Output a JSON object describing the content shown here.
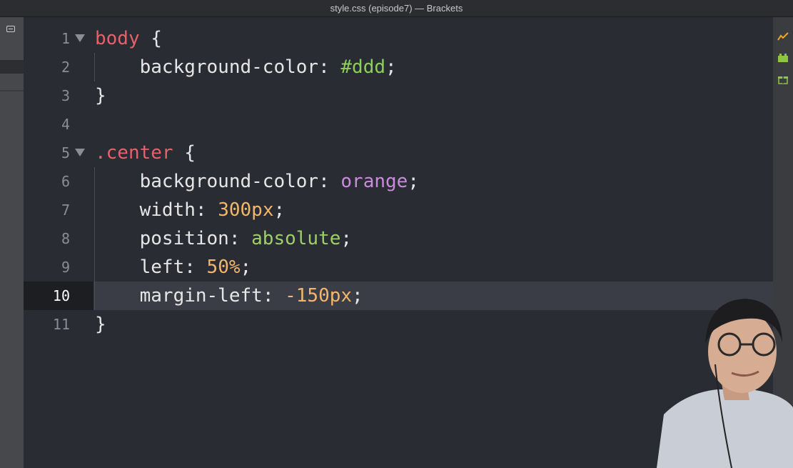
{
  "window": {
    "title": "style.css (episode7) — Brackets"
  },
  "editor": {
    "active_line": "10",
    "lines": [
      {
        "num": "1",
        "fold": true,
        "tokens": [
          [
            "tok-sel",
            "body"
          ],
          [
            "tok-punc",
            " {"
          ]
        ]
      },
      {
        "num": "2",
        "fold": false,
        "indent": true,
        "tokens": [
          [
            "tok-prop",
            "    background-color"
          ],
          [
            "tok-punc",
            ": "
          ],
          [
            "tok-hex",
            "#ddd"
          ],
          [
            "tok-punc",
            ";"
          ]
        ]
      },
      {
        "num": "3",
        "fold": false,
        "tokens": [
          [
            "tok-punc",
            "}"
          ]
        ]
      },
      {
        "num": "4",
        "fold": false,
        "tokens": []
      },
      {
        "num": "5",
        "fold": true,
        "tokens": [
          [
            "tok-sel",
            ".center"
          ],
          [
            "tok-punc",
            " {"
          ]
        ]
      },
      {
        "num": "6",
        "fold": false,
        "indent": true,
        "tokens": [
          [
            "tok-prop",
            "    background-color"
          ],
          [
            "tok-punc",
            ": "
          ],
          [
            "tok-kw",
            "orange"
          ],
          [
            "tok-punc",
            ";"
          ]
        ]
      },
      {
        "num": "7",
        "fold": false,
        "indent": true,
        "tokens": [
          [
            "tok-prop",
            "    width"
          ],
          [
            "tok-punc",
            ": "
          ],
          [
            "tok-num",
            "300px"
          ],
          [
            "tok-punc",
            ";"
          ]
        ]
      },
      {
        "num": "8",
        "fold": false,
        "indent": true,
        "tokens": [
          [
            "tok-prop",
            "    position"
          ],
          [
            "tok-punc",
            ": "
          ],
          [
            "tok-green",
            "absolute"
          ],
          [
            "tok-punc",
            ";"
          ]
        ]
      },
      {
        "num": "9",
        "fold": false,
        "indent": true,
        "tokens": [
          [
            "tok-prop",
            "    left"
          ],
          [
            "tok-punc",
            ": "
          ],
          [
            "tok-num",
            "50%"
          ],
          [
            "tok-punc",
            ";"
          ]
        ]
      },
      {
        "num": "10",
        "fold": false,
        "indent": true,
        "active": true,
        "tokens": [
          [
            "tok-prop",
            "    margin-left"
          ],
          [
            "tok-punc",
            ": "
          ],
          [
            "tok-num",
            "-150px"
          ],
          [
            "tok-punc",
            ";"
          ]
        ]
      },
      {
        "num": "11",
        "fold": false,
        "tokens": [
          [
            "tok-punc",
            "}"
          ]
        ]
      }
    ]
  },
  "rightbar": {
    "icons": [
      "live-preview-icon",
      "extension-manager-icon",
      "gift-icon"
    ],
    "colors": {
      "live": "#f5a623",
      "ext": "#8dc63f"
    }
  },
  "overlay": {
    "webcam": "presenter-webcam"
  }
}
